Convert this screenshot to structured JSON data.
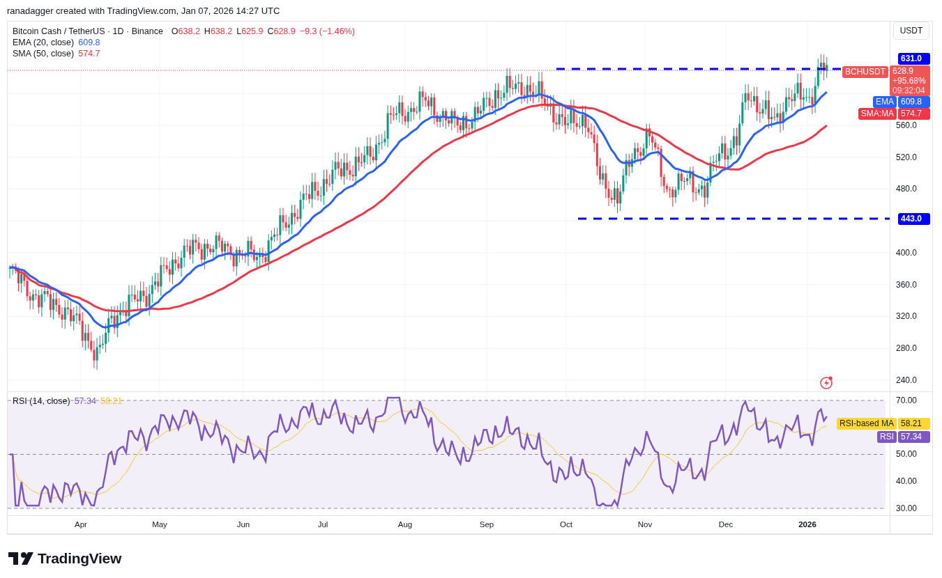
{
  "header": {
    "credit": "ranadagger created with TradingView.com, Jan 07, 2026 14:27 UTC"
  },
  "legend": {
    "symbol": "Bitcoin Cash / TetherUS · 1D · Binance",
    "ohlc": [
      {
        "key": "O",
        "value": "638.2"
      },
      {
        "key": "H",
        "value": "638.2"
      },
      {
        "key": "L",
        "value": "625.9"
      },
      {
        "key": "C",
        "value": "628.9"
      }
    ],
    "change": "−9.3 (−1.46%)"
  },
  "indicators": [
    {
      "name": "EMA (20, close)",
      "value": "609.8",
      "color": "#2962ff"
    },
    {
      "name": "SMA (50, close)",
      "value": "574.7",
      "color": "#f23645"
    }
  ],
  "price_axis": {
    "currency": "USDT",
    "ticks": [
      "560.0",
      "520.0",
      "480.0",
      "400.0",
      "360.0",
      "320.0",
      "280.0",
      "240.0"
    ]
  },
  "price_tags": [
    {
      "kind": "line",
      "value": "631.0"
    },
    {
      "kind": "last",
      "tag": "BCHUSDT",
      "value": "628.9",
      "change": "+95.68%",
      "countdown": "09:32:04"
    },
    {
      "kind": "indicator",
      "tag": "EMA",
      "value": "609.8",
      "color": "#2962ff"
    },
    {
      "kind": "indicator",
      "tag": "SMA:MA",
      "value": "574.7",
      "color": "#f23645"
    },
    {
      "kind": "line",
      "value": "443.0"
    }
  ],
  "rsi": {
    "name": "RSI (14, close)",
    "values": [
      {
        "value": "57.34",
        "color": "#7e57c2"
      },
      {
        "value": "58.21",
        "color": "#f7c52b"
      }
    ],
    "ticks": [
      "70.00",
      "50.00",
      "40.00",
      "30.00"
    ],
    "tags": [
      {
        "tag": "RSI-based MA",
        "value": "58.21",
        "color": "#fdd835"
      },
      {
        "tag": "RSI",
        "value": "57.34",
        "color": "#7e57c2"
      }
    ]
  },
  "time_axis": [
    {
      "label": "Apr",
      "emphasized": false
    },
    {
      "label": "May",
      "emphasized": false
    },
    {
      "label": "Jun",
      "emphasized": false
    },
    {
      "label": "Jul",
      "emphasized": false
    },
    {
      "label": "Aug",
      "emphasized": false
    },
    {
      "label": "Sep",
      "emphasized": false
    },
    {
      "label": "Oct",
      "emphasized": false
    },
    {
      "label": "Nov",
      "emphasized": false
    },
    {
      "label": "Dec",
      "emphasized": false
    },
    {
      "label": "2026",
      "emphasized": true
    }
  ],
  "footer": {
    "brand": "TradingView"
  }
}
